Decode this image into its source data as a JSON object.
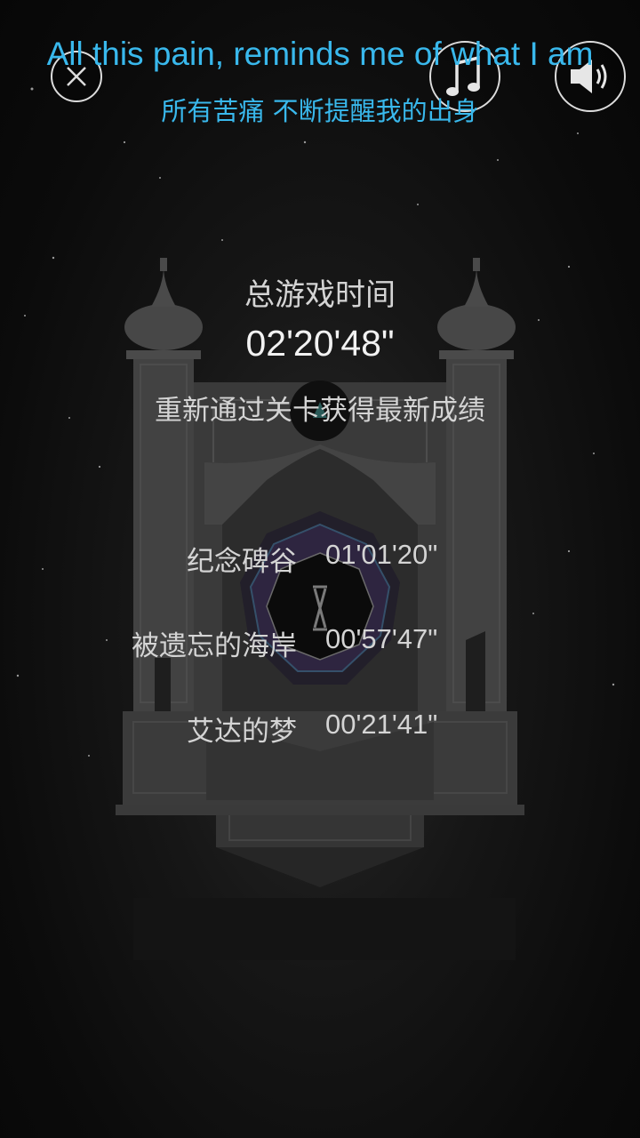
{
  "subtitles": {
    "english": "All this pain, reminds me of what I am",
    "chinese": "所有苦痛 不断提醒我的出身"
  },
  "controls": {
    "close_icon": "close-icon",
    "music_icon": "music-note-icon",
    "sound_icon": "speaker-icon"
  },
  "summary": {
    "total_label": "总游戏时间",
    "total_time": "02'20'48\"",
    "hint": "重新通过关卡获得最新成绩"
  },
  "levels": [
    {
      "name": "纪念碑谷",
      "time": "01'01'20\""
    },
    {
      "name": "被遗忘的海岸",
      "time": "00'57'47\""
    },
    {
      "name": "艾达的梦",
      "time": "00'21'41\""
    }
  ],
  "colors": {
    "subtitle": "#39b8ec",
    "text": "#d4d4d4",
    "background": "#0c0c0c"
  }
}
